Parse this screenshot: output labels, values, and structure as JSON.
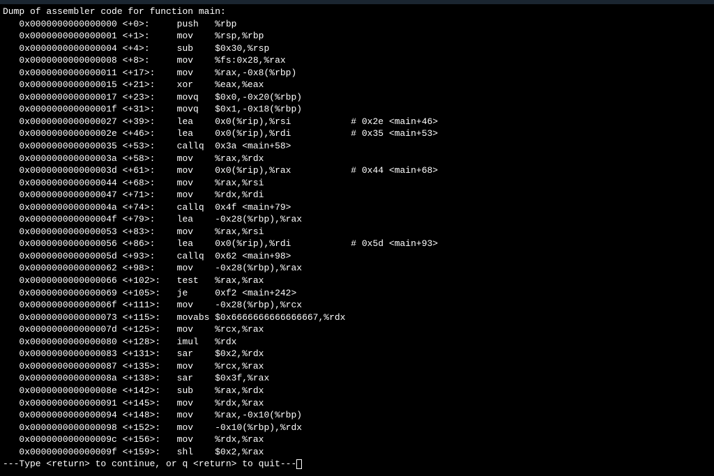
{
  "header": "Dump of assembler code for function main:",
  "lines": [
    {
      "addr": "0x0000000000000000",
      "off": "<+0>:",
      "mnem": "push",
      "ops": "%rbp",
      "cmt": ""
    },
    {
      "addr": "0x0000000000000001",
      "off": "<+1>:",
      "mnem": "mov",
      "ops": "%rsp,%rbp",
      "cmt": ""
    },
    {
      "addr": "0x0000000000000004",
      "off": "<+4>:",
      "mnem": "sub",
      "ops": "$0x30,%rsp",
      "cmt": ""
    },
    {
      "addr": "0x0000000000000008",
      "off": "<+8>:",
      "mnem": "mov",
      "ops": "%fs:0x28,%rax",
      "cmt": ""
    },
    {
      "addr": "0x0000000000000011",
      "off": "<+17>:",
      "mnem": "mov",
      "ops": "%rax,-0x8(%rbp)",
      "cmt": ""
    },
    {
      "addr": "0x0000000000000015",
      "off": "<+21>:",
      "mnem": "xor",
      "ops": "%eax,%eax",
      "cmt": ""
    },
    {
      "addr": "0x0000000000000017",
      "off": "<+23>:",
      "mnem": "movq",
      "ops": "$0x0,-0x20(%rbp)",
      "cmt": ""
    },
    {
      "addr": "0x000000000000001f",
      "off": "<+31>:",
      "mnem": "movq",
      "ops": "$0x1,-0x18(%rbp)",
      "cmt": ""
    },
    {
      "addr": "0x0000000000000027",
      "off": "<+39>:",
      "mnem": "lea",
      "ops": "0x0(%rip),%rsi",
      "cmt": "# 0x2e <main+46>"
    },
    {
      "addr": "0x000000000000002e",
      "off": "<+46>:",
      "mnem": "lea",
      "ops": "0x0(%rip),%rdi",
      "cmt": "# 0x35 <main+53>"
    },
    {
      "addr": "0x0000000000000035",
      "off": "<+53>:",
      "mnem": "callq",
      "ops": "0x3a <main+58>",
      "cmt": ""
    },
    {
      "addr": "0x000000000000003a",
      "off": "<+58>:",
      "mnem": "mov",
      "ops": "%rax,%rdx",
      "cmt": ""
    },
    {
      "addr": "0x000000000000003d",
      "off": "<+61>:",
      "mnem": "mov",
      "ops": "0x0(%rip),%rax",
      "cmt": "# 0x44 <main+68>"
    },
    {
      "addr": "0x0000000000000044",
      "off": "<+68>:",
      "mnem": "mov",
      "ops": "%rax,%rsi",
      "cmt": ""
    },
    {
      "addr": "0x0000000000000047",
      "off": "<+71>:",
      "mnem": "mov",
      "ops": "%rdx,%rdi",
      "cmt": ""
    },
    {
      "addr": "0x000000000000004a",
      "off": "<+74>:",
      "mnem": "callq",
      "ops": "0x4f <main+79>",
      "cmt": ""
    },
    {
      "addr": "0x000000000000004f",
      "off": "<+79>:",
      "mnem": "lea",
      "ops": "-0x28(%rbp),%rax",
      "cmt": ""
    },
    {
      "addr": "0x0000000000000053",
      "off": "<+83>:",
      "mnem": "mov",
      "ops": "%rax,%rsi",
      "cmt": ""
    },
    {
      "addr": "0x0000000000000056",
      "off": "<+86>:",
      "mnem": "lea",
      "ops": "0x0(%rip),%rdi",
      "cmt": "# 0x5d <main+93>"
    },
    {
      "addr": "0x000000000000005d",
      "off": "<+93>:",
      "mnem": "callq",
      "ops": "0x62 <main+98>",
      "cmt": ""
    },
    {
      "addr": "0x0000000000000062",
      "off": "<+98>:",
      "mnem": "mov",
      "ops": "-0x28(%rbp),%rax",
      "cmt": ""
    },
    {
      "addr": "0x0000000000000066",
      "off": "<+102>:",
      "mnem": "test",
      "ops": "%rax,%rax",
      "cmt": ""
    },
    {
      "addr": "0x0000000000000069",
      "off": "<+105>:",
      "mnem": "je",
      "ops": "0xf2 <main+242>",
      "cmt": ""
    },
    {
      "addr": "0x000000000000006f",
      "off": "<+111>:",
      "mnem": "mov",
      "ops": "-0x28(%rbp),%rcx",
      "cmt": ""
    },
    {
      "addr": "0x0000000000000073",
      "off": "<+115>:",
      "mnem": "movabs",
      "ops": "$0x6666666666666667,%rdx",
      "cmt": ""
    },
    {
      "addr": "0x000000000000007d",
      "off": "<+125>:",
      "mnem": "mov",
      "ops": "%rcx,%rax",
      "cmt": ""
    },
    {
      "addr": "0x0000000000000080",
      "off": "<+128>:",
      "mnem": "imul",
      "ops": "%rdx",
      "cmt": ""
    },
    {
      "addr": "0x0000000000000083",
      "off": "<+131>:",
      "mnem": "sar",
      "ops": "$0x2,%rdx",
      "cmt": ""
    },
    {
      "addr": "0x0000000000000087",
      "off": "<+135>:",
      "mnem": "mov",
      "ops": "%rcx,%rax",
      "cmt": ""
    },
    {
      "addr": "0x000000000000008a",
      "off": "<+138>:",
      "mnem": "sar",
      "ops": "$0x3f,%rax",
      "cmt": ""
    },
    {
      "addr": "0x000000000000008e",
      "off": "<+142>:",
      "mnem": "sub",
      "ops": "%rax,%rdx",
      "cmt": ""
    },
    {
      "addr": "0x0000000000000091",
      "off": "<+145>:",
      "mnem": "mov",
      "ops": "%rdx,%rax",
      "cmt": ""
    },
    {
      "addr": "0x0000000000000094",
      "off": "<+148>:",
      "mnem": "mov",
      "ops": "%rax,-0x10(%rbp)",
      "cmt": ""
    },
    {
      "addr": "0x0000000000000098",
      "off": "<+152>:",
      "mnem": "mov",
      "ops": "-0x10(%rbp),%rdx",
      "cmt": ""
    },
    {
      "addr": "0x000000000000009c",
      "off": "<+156>:",
      "mnem": "mov",
      "ops": "%rdx,%rax",
      "cmt": ""
    },
    {
      "addr": "0x000000000000009f",
      "off": "<+159>:",
      "mnem": "shl",
      "ops": "$0x2,%rax",
      "cmt": ""
    }
  ],
  "prompt": "---Type <return> to continue, or q <return> to quit---"
}
